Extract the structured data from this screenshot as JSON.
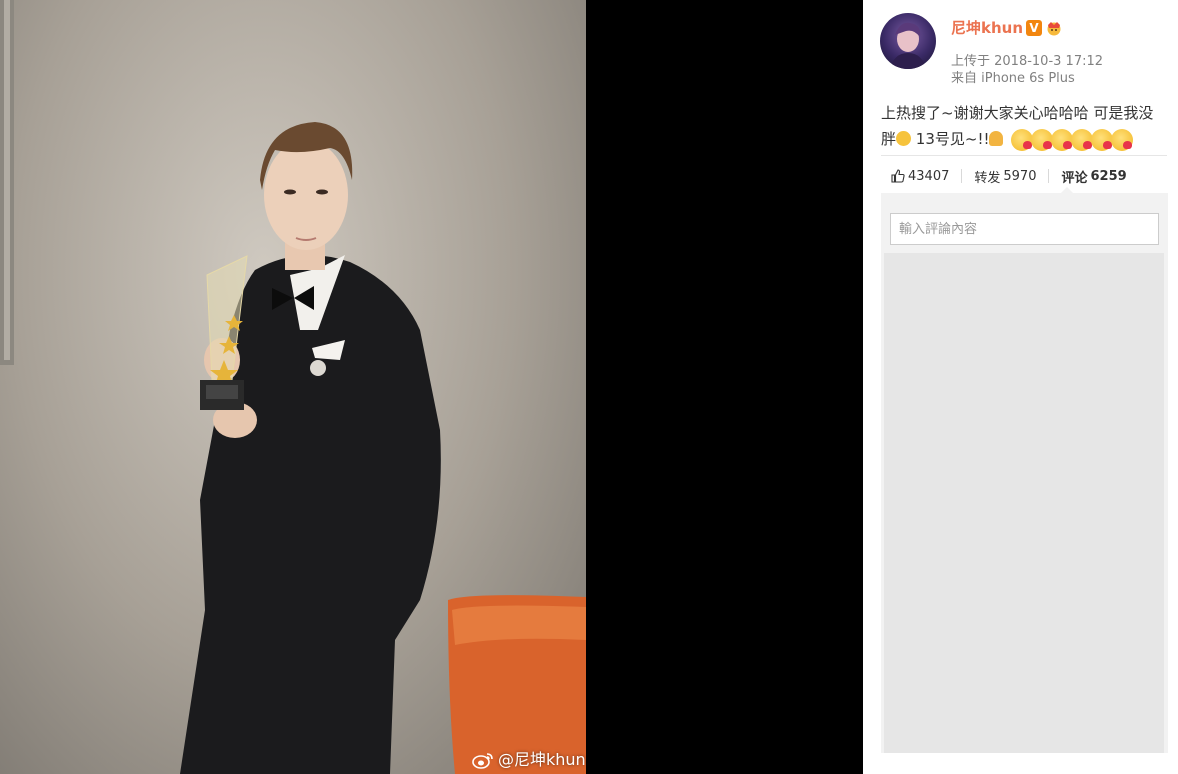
{
  "photo": {
    "watermark": "@尼坤khun",
    "watermark_icon": "weibo-logo-icon",
    "trophy_plaque": "新浪网"
  },
  "post": {
    "author": {
      "name": "尼坤khun",
      "verified_badge": "V",
      "avatar_icon": "avatar",
      "extra_badge_icon": "crown-badge-icon"
    },
    "upload_time": "上传于 2018-10-3 17:12",
    "source": "来自 iPhone 6s Plus",
    "text_line1": "上热搜了~谢谢大家关心哈哈哈 可是我没",
    "text_line2_prefix": "胖",
    "text_line2_mid": " 13号见~!!",
    "emojis": [
      "laughing-tears-emoji",
      "pray-emoji",
      "kiss-emoji",
      "kiss-emoji",
      "kiss-emoji",
      "kiss-emoji",
      "kiss-emoji",
      "kiss-emoji"
    ]
  },
  "actions": {
    "like_count": "43407",
    "repost_label": "转发",
    "repost_count": "5970",
    "comment_label": "评论",
    "comment_count": "6259"
  },
  "comment": {
    "placeholder": "輸入評論內容"
  },
  "colors": {
    "author_name": "#eb7350",
    "verified_badge": "#f2860f",
    "panel_bg": "#ffffff",
    "comment_area_bg": "#f2f2f2"
  }
}
